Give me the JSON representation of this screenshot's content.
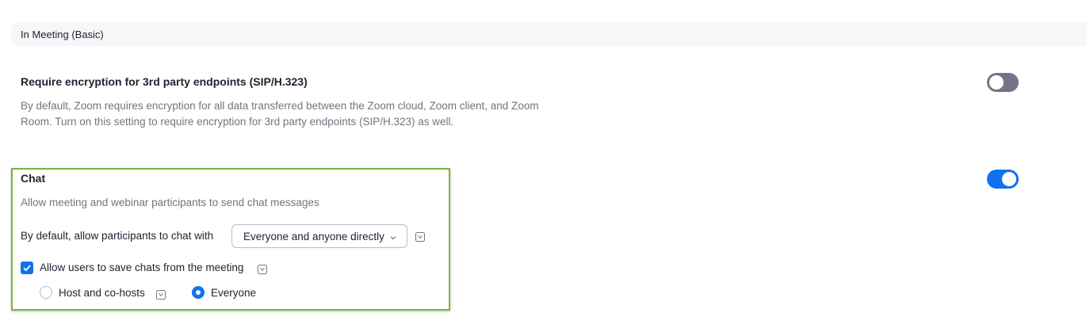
{
  "section": {
    "title": "In Meeting (Basic)"
  },
  "settings": [
    {
      "title": "Require encryption for 3rd party endpoints (SIP/H.323)",
      "description_line1": "By default, Zoom requires encryption for all data transferred between the Zoom cloud, Zoom client, and Zoom",
      "description_line2": "Room. Turn on this setting to require encryption for 3rd party endpoints (SIP/H.323) as well.",
      "enabled": false
    },
    {
      "title": "Chat",
      "description": "Allow meeting and webinar participants to send chat messages",
      "enabled": true,
      "default_chat_label": "By default, allow participants to chat with",
      "default_chat_value": "Everyone and anyone directly",
      "save_chats_label": "Allow users to save chats from the meeting",
      "save_chats_checked": true,
      "save_options": [
        {
          "label": "Host and co-hosts",
          "selected": false
        },
        {
          "label": "Everyone",
          "selected": true
        }
      ]
    }
  ],
  "colors": {
    "accent": "#0e72ed",
    "toggle_off": "#747487",
    "highlight_border": "#7cb342",
    "muted_text": "#6e7680"
  },
  "icons": {
    "info": "info-icon",
    "chevron": "chevron-down-icon",
    "check": "check-icon"
  }
}
